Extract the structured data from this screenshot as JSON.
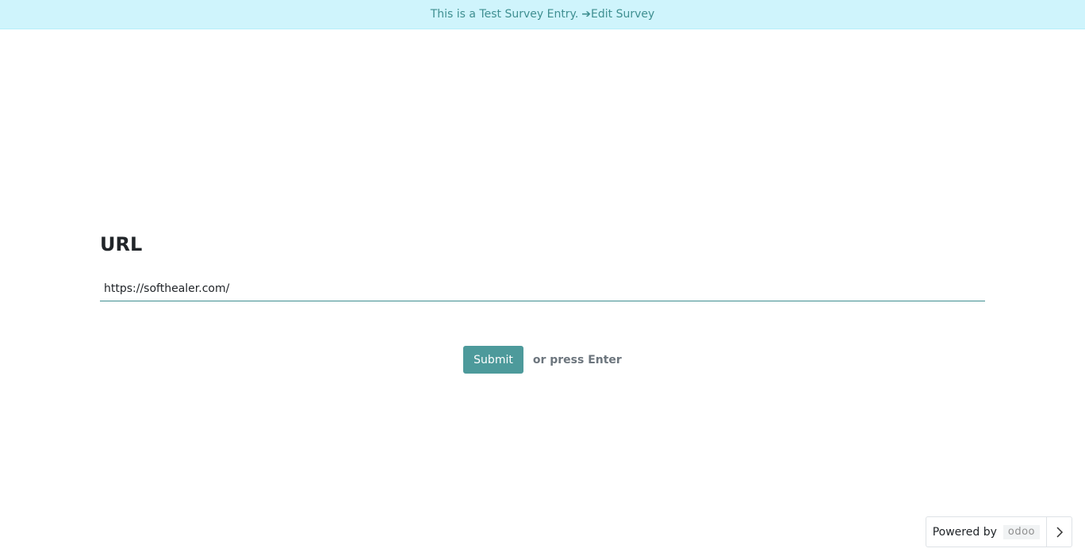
{
  "banner": {
    "text": "This is a Test Survey Entry.",
    "arrow": "➔",
    "edit_link_label": "Edit Survey"
  },
  "question": {
    "title": "URL",
    "answer_value": "https://softhealer.com/"
  },
  "actions": {
    "submit_label": "Submit",
    "hint": "or press Enter"
  },
  "footer": {
    "powered_label": "Powered by",
    "logo_text": "odoo",
    "toggle_icon": "chevron-right-icon"
  },
  "colors": {
    "accent": "#4d9a9b",
    "banner_bg": "#cff4fc",
    "banner_text": "#3f8f91"
  }
}
